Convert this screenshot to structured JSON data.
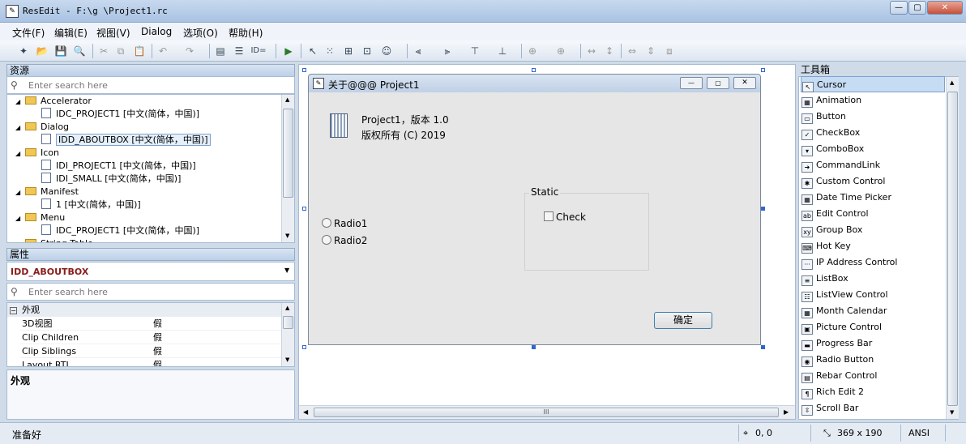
{
  "window": {
    "title": "ResEdit - F:\\g                          \\Project1.rc"
  },
  "menu": [
    "文件(F)",
    "编辑(E)",
    "视图(V)",
    "Dialog",
    "选项(O)",
    "帮助(H)"
  ],
  "toolbar": {
    "id_label": "ID="
  },
  "resources": {
    "header": "资源",
    "search_placeholder": "Enter search here",
    "items": [
      {
        "label": "Accelerator",
        "kind": "folder",
        "level": 0
      },
      {
        "label": "IDC_PROJECT1 [中文(简体，中国)]",
        "kind": "file",
        "level": 1
      },
      {
        "label": "Dialog",
        "kind": "folder",
        "level": 0
      },
      {
        "label": "IDD_ABOUTBOX [中文(简体，中国)]",
        "kind": "file",
        "level": 1,
        "selected": true
      },
      {
        "label": "Icon",
        "kind": "folder",
        "level": 0
      },
      {
        "label": "IDI_PROJECT1 [中文(简体，中国)]",
        "kind": "file",
        "level": 1
      },
      {
        "label": "IDI_SMALL [中文(简体，中国)]",
        "kind": "file",
        "level": 1
      },
      {
        "label": "Manifest",
        "kind": "folder",
        "level": 0
      },
      {
        "label": "1 [中文(简体，中国)]",
        "kind": "file",
        "level": 1
      },
      {
        "label": "Menu",
        "kind": "folder",
        "level": 0
      },
      {
        "label": "IDC_PROJECT1 [中文(简体，中国)]",
        "kind": "file",
        "level": 1
      },
      {
        "label": "String Table",
        "kind": "folder",
        "level": 0
      }
    ]
  },
  "properties": {
    "header": "属性",
    "selected_object": "IDD_ABOUTBOX",
    "search_placeholder": "Enter search here",
    "category": "外观",
    "rows": [
      {
        "name": "3D视图",
        "value": "假"
      },
      {
        "name": "Clip Children",
        "value": "假"
      },
      {
        "name": "Clip Siblings",
        "value": "假"
      },
      {
        "name": "Layout RTL",
        "value": "假"
      }
    ],
    "description_title": "外观"
  },
  "dialog": {
    "title": "关于@@@ Project1",
    "text_line1": "Project1，版本 1.0",
    "text_line2": "版权所有 (C) 2019",
    "radio1": "Radio1",
    "radio2": "Radio2",
    "group_label": "Static",
    "checkbox_label": "Check",
    "ok_button": "确定"
  },
  "hscroll": {
    "grip": "III"
  },
  "toolbox": {
    "header": "工具箱",
    "items": [
      {
        "label": "Cursor",
        "icon": "cursor-icon",
        "selected": true
      },
      {
        "label": "Animation",
        "icon": "film-icon"
      },
      {
        "label": "Button",
        "icon": "button-icon"
      },
      {
        "label": "CheckBox",
        "icon": "checkbox-icon"
      },
      {
        "label": "ComboBox",
        "icon": "combobox-icon"
      },
      {
        "label": "CommandLink",
        "icon": "commandlink-icon"
      },
      {
        "label": "Custom Control",
        "icon": "custom-control-icon"
      },
      {
        "label": "Date Time Picker",
        "icon": "calendar-icon"
      },
      {
        "label": "Edit Control",
        "icon": "edit-icon"
      },
      {
        "label": "Group Box",
        "icon": "groupbox-icon"
      },
      {
        "label": "Hot Key",
        "icon": "hotkey-icon"
      },
      {
        "label": "IP Address Control",
        "icon": "ip-icon"
      },
      {
        "label": "ListBox",
        "icon": "listbox-icon"
      },
      {
        "label": "ListView Control",
        "icon": "listview-icon"
      },
      {
        "label": "Month Calendar",
        "icon": "month-calendar-icon"
      },
      {
        "label": "Picture Control",
        "icon": "picture-icon"
      },
      {
        "label": "Progress Bar",
        "icon": "progress-icon"
      },
      {
        "label": "Radio Button",
        "icon": "radio-icon"
      },
      {
        "label": "Rebar Control",
        "icon": "rebar-icon"
      },
      {
        "label": "Rich Edit 2",
        "icon": "richedit-icon"
      },
      {
        "label": "Scroll Bar",
        "icon": "scrollbar-icon"
      }
    ]
  },
  "status": {
    "ready": "准备好",
    "position": "0, 0",
    "size": "369 x 190",
    "encoding": "ANSI"
  }
}
